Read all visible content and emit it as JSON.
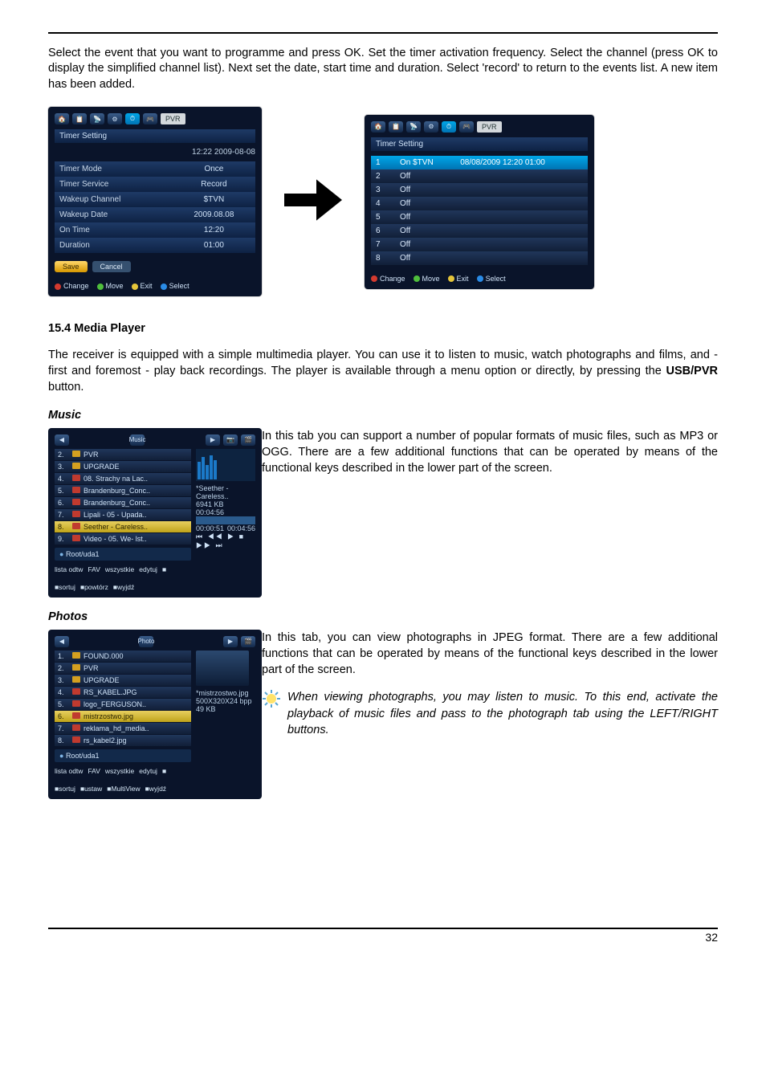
{
  "intro_text": "Select the event that you want to programme and press OK. Set the timer activation frequency. Select the channel (press OK to display the simplified channel list). Next set the date, start time and duration. Select 'record' to return to the events list. A new item has been added.",
  "screenshot1": {
    "title": "Timer Setting",
    "datetime": "12:22 2009-08-08",
    "fields": [
      {
        "label": "Timer Mode",
        "value": "Once"
      },
      {
        "label": "Timer Service",
        "value": "Record"
      },
      {
        "label": "Wakeup Channel",
        "value": "$TVN"
      },
      {
        "label": "Wakeup Date",
        "value": "2009.08.08"
      },
      {
        "label": "On Time",
        "value": "12:20"
      },
      {
        "label": "Duration",
        "value": "01:00"
      }
    ],
    "save": "Save",
    "cancel": "Cancel",
    "footer": [
      "Change",
      "Move",
      "Exit",
      "Select"
    ]
  },
  "screenshot2": {
    "title": "Timer Setting",
    "first_row": [
      "1",
      "On",
      "$TVN",
      "08/08/2009 12:20 01:00"
    ],
    "rows": [
      [
        "2",
        "Off"
      ],
      [
        "3",
        "Off"
      ],
      [
        "4",
        "Off"
      ],
      [
        "5",
        "Off"
      ],
      [
        "6",
        "Off"
      ],
      [
        "7",
        "Off"
      ],
      [
        "8",
        "Off"
      ]
    ],
    "footer": [
      "Change",
      "Move",
      "Exit",
      "Select"
    ]
  },
  "pvr_label": "PVR",
  "section_heading": "15.4 Media Player",
  "section_body_a": "The receiver is equipped with a simple multimedia player. You can use it to listen to music, watch photographs and films, and - first and foremost - play back recordings. The player is available through a menu option or directly, by pressing the ",
  "usb_pvr": "USB/PVR",
  "section_body_b": " button.",
  "music_heading": "Music",
  "music_shot": {
    "tab": "Music",
    "list": [
      {
        "num": "2.",
        "label": "PVR",
        "folder": true
      },
      {
        "num": "3.",
        "label": "UPGRADE",
        "folder": true
      },
      {
        "num": "4.",
        "label": "08. Strachy na Lac.."
      },
      {
        "num": "5.",
        "label": "Brandenburg_Conc.."
      },
      {
        "num": "6.",
        "label": "Brandenburg_Conc.."
      },
      {
        "num": "7.",
        "label": "Lipali - 05 - Upada.."
      },
      {
        "num": "8.",
        "label": "Seether - Careless..",
        "hl": true
      },
      {
        "num": "9.",
        "label": "Video - 05. We- lst.."
      }
    ],
    "selected_name": "*Seether - Careless..",
    "selected_size": "6941 KB",
    "elapsed_total": "00:04:56",
    "time_left": "00:00:51",
    "time_right": "00:04:56",
    "root": "Root/uda1",
    "foot": [
      "lista odtw",
      "FAV",
      "wszystkie",
      "edytuj",
      "sortuj",
      "powtórz",
      "wyjdź"
    ]
  },
  "music_text": "In this tab you can support a number of popular formats of music files, such as MP3 or OGG. There are a few additional functions that can be operated by means of the functional keys described in the lower part of the screen.",
  "photos_heading": "Photos",
  "photos_shot": {
    "tab": "Photo",
    "list": [
      {
        "num": "1.",
        "label": "FOUND.000",
        "folder": true
      },
      {
        "num": "2.",
        "label": "PVR",
        "folder": true
      },
      {
        "num": "3.",
        "label": "UPGRADE",
        "folder": true
      },
      {
        "num": "4.",
        "label": "RS_KABEL.JPG"
      },
      {
        "num": "5.",
        "label": "logo_FERGUSON.."
      },
      {
        "num": "6.",
        "label": "mistrzostwo.jpg",
        "hl": true
      },
      {
        "num": "7.",
        "label": "reklama_hd_media.."
      },
      {
        "num": "8.",
        "label": "rs_kabel2.jpg"
      }
    ],
    "selected_name": "*mistrzostwo.jpg",
    "selected_dim": "500X320X24 bpp",
    "selected_size": "49 KB",
    "root": "Root/uda1",
    "foot": [
      "lista odtw",
      "FAV",
      "wszystkie",
      "edytuj",
      "sortuj",
      "ustaw",
      "MultiView",
      "wyjdź"
    ]
  },
  "photos_text": "In this tab, you can view photographs in JPEG format. There are a few additional functions that can be operated by means of the functional keys described in the lower part of the screen.",
  "photos_note": "When viewing photographs, you may listen to music. To this end, activate the playback of music files and pass to the photograph tab using the LEFT/RIGHT buttons.",
  "page_number": "32"
}
